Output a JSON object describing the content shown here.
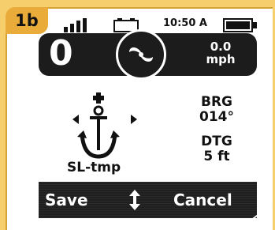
{
  "figure_label": "1b",
  "status": {
    "time": "10:50 A",
    "icons": [
      "signal-strength-icon",
      "boat-battery-icon",
      "device-battery-icon"
    ]
  },
  "info_bar": {
    "count": "0",
    "motor_icon": "trolling-motor-prop-icon",
    "speed_value": "0.0",
    "speed_unit": "mph"
  },
  "anchor": {
    "icon": "anchor-icon",
    "name": "SL-tmp",
    "nav_icons": [
      "left-arrow-icon",
      "right-arrow-icon",
      "plus-icon"
    ]
  },
  "readout": {
    "brg_label": "BRG",
    "brg_value": "014°",
    "dtg_label": "DTG",
    "dtg_value": "5 ft"
  },
  "actions": {
    "save": "Save",
    "cancel": "Cancel",
    "toggle_icon": "up-down-arrow-icon"
  },
  "colors": {
    "background": "#f6ce6c",
    "badge": "#e9ac3a",
    "bar": "#1c1c1c",
    "text": "#111111"
  }
}
